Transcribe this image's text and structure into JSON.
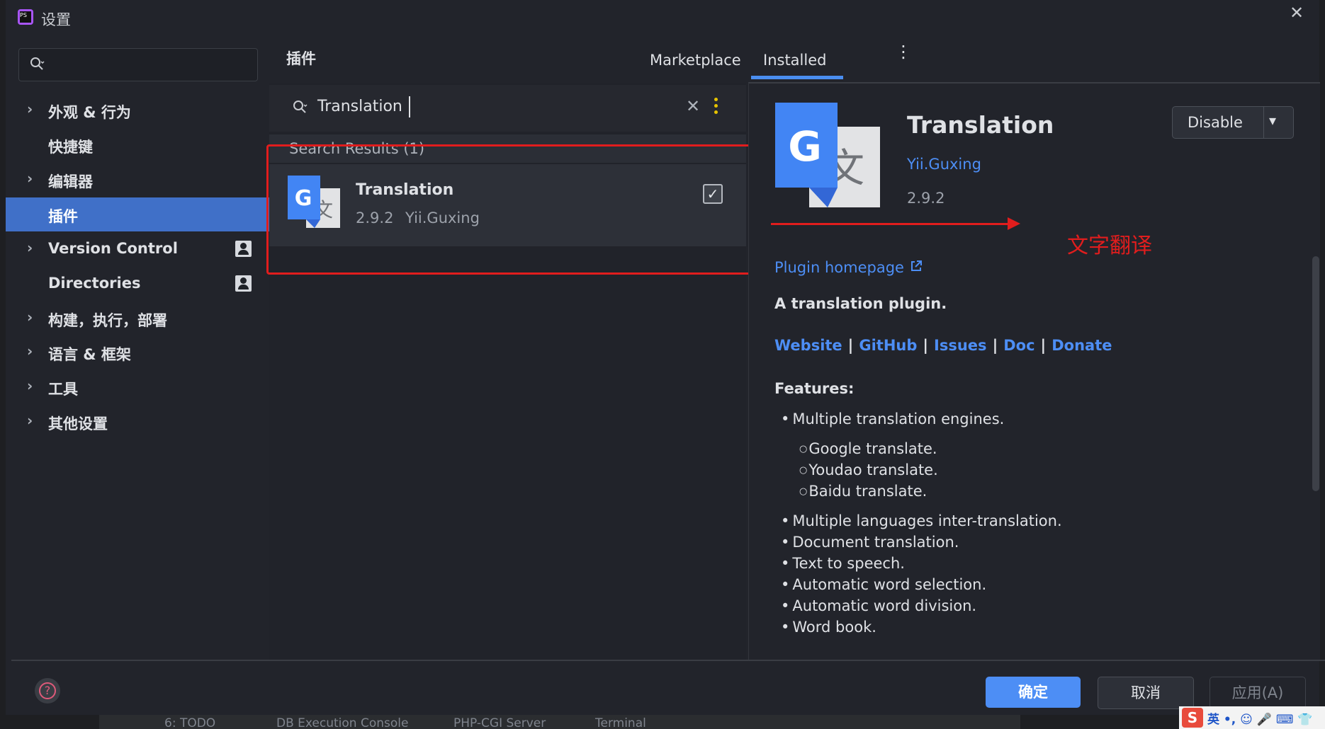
{
  "window": {
    "title": "设置",
    "app_icon_text": "PS",
    "close_glyph": "✕"
  },
  "sidebar": {
    "search_placeholder": "",
    "items": [
      {
        "label": "外观 & 行为",
        "expandable": true
      },
      {
        "label": "快捷键",
        "expandable": false
      },
      {
        "label": "编辑器",
        "expandable": true
      },
      {
        "label": "插件",
        "expandable": false,
        "active": true
      },
      {
        "label": "Version Control",
        "expandable": true,
        "badge": "person-icon"
      },
      {
        "label": "Directories",
        "expandable": false,
        "badge": "person-icon"
      },
      {
        "label": "构建，执行，部署",
        "expandable": true
      },
      {
        "label": "语言 & 框架",
        "expandable": true
      },
      {
        "label": "工具",
        "expandable": true
      },
      {
        "label": "其他设置",
        "expandable": true
      }
    ]
  },
  "header": {
    "section_title": "插件",
    "tabs": [
      {
        "label": "Marketplace"
      },
      {
        "label": "Installed",
        "active": true
      }
    ],
    "more_glyph": "⋮"
  },
  "plugin_list": {
    "search_value": "Translation",
    "clear_glyph": "✕",
    "results_header": "Search Results (1)",
    "rows": [
      {
        "title": "Translation",
        "version": "2.9.2",
        "vendor": "Yii.Guxing",
        "enabled": true,
        "check_glyph": "✓"
      }
    ]
  },
  "detail": {
    "title": "Translation",
    "vendor": "Yii.Guxing",
    "version": "2.9.2",
    "disable_label": "Disable",
    "dropdown_glyph": "▾",
    "annotation": "文字翻译",
    "homepage_label": "Plugin homepage",
    "description": "A translation plugin.",
    "links": [
      "Website",
      "GitHub",
      "Issues",
      "Doc",
      "Donate"
    ],
    "link_separator": "|",
    "features_title": "Features:",
    "features": [
      "Multiple translation engines.",
      "Multiple languages inter-translation.",
      "Document translation.",
      "Text to speech.",
      "Automatic word selection.",
      "Automatic word division.",
      "Word book."
    ],
    "engines": [
      "Google translate.",
      "Youdao translate.",
      "Baidu translate."
    ]
  },
  "footer": {
    "help_glyph": "?",
    "ok_label": "确定",
    "cancel_label": "取消",
    "apply_label": "应用(A)"
  },
  "background_ide": {
    "tool_windows": [
      "6: TODO",
      "DB Execution Console",
      "PHP-CGI Server",
      "Terminal"
    ]
  },
  "ime": {
    "logo": "S",
    "mode": "英 •, ☺ 🎤 ⌨ 👕"
  },
  "colors": {
    "accent": "#4d8ef5",
    "selection": "#4070c8",
    "annotation_red": "#e11d1d",
    "google_blue": "#4285f4"
  }
}
